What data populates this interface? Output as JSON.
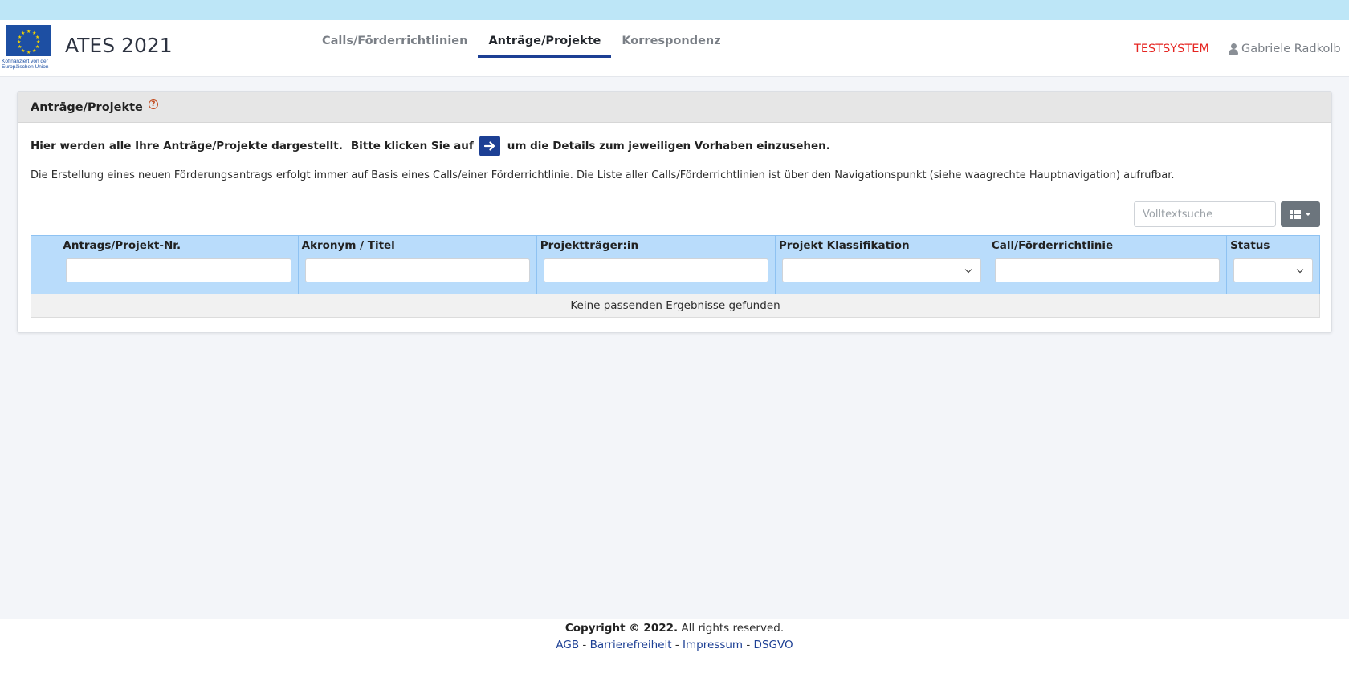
{
  "header": {
    "eu_caption_line1": "Kofinanziert von der",
    "eu_caption_line2": "Europäischen Union",
    "app_title": "ATES 2021",
    "nav": [
      {
        "label": "Calls/Förderrichtlinien",
        "active": false
      },
      {
        "label": "Anträge/Projekte",
        "active": true
      },
      {
        "label": "Korrespondenz",
        "active": false
      }
    ],
    "environment": "TESTSYSTEM",
    "user_name": "Gabriele Radkolb"
  },
  "card": {
    "title": "Anträge/Projekte",
    "help_symbol": "?",
    "intro_part1": "Hier werden alle Ihre Anträge/Projekte dargestellt.",
    "intro_part2": "Bitte klicken Sie auf",
    "intro_part3": "um die Details zum jeweiligen Vorhaben einzusehen.",
    "info": "Die Erstellung eines neuen Förderungsantrags erfolgt immer auf Basis eines Calls/einer Förderrichtlinie. Die Liste aller Calls/Förderrichtlinien ist über den Navigationspunkt (siehe waagrechte Hauptnavigation) aufrufbar.",
    "search_placeholder": "Volltextsuche"
  },
  "table": {
    "columns": [
      {
        "label": "Antrags/Projekt-Nr.",
        "filter": "text",
        "value": ""
      },
      {
        "label": "Akronym / Titel",
        "filter": "text",
        "value": ""
      },
      {
        "label": "Projektträger:in",
        "filter": "text",
        "value": ""
      },
      {
        "label": "Projekt Klassifikation",
        "filter": "select",
        "value": ""
      },
      {
        "label": "Call/Förderrichtlinie",
        "filter": "text",
        "value": ""
      },
      {
        "label": "Status",
        "filter": "select",
        "value": ""
      }
    ],
    "empty_message": "Keine passenden Ergebnisse gefunden"
  },
  "footer": {
    "copyright_bold": "Copyright © 2022.",
    "copyright_rest": " All rights reserved.",
    "links": [
      "AGB",
      "Barrierefreiheit",
      "Impressum",
      "DSGVO"
    ],
    "separator": " - "
  },
  "colors": {
    "topbar": "#bde6f7",
    "accent": "#1c3f94",
    "testsystem": "#e52521",
    "table_header": "#b9dcfb",
    "help_icon": "#c24a1c"
  },
  "icons": {
    "eu_flag": "eu-flag-icon",
    "help": "help-circle-icon",
    "arrow": "arrow-right-icon",
    "user": "user-icon",
    "column_toggle": "table-columns-icon",
    "dropdown": "chevron-down-icon"
  }
}
